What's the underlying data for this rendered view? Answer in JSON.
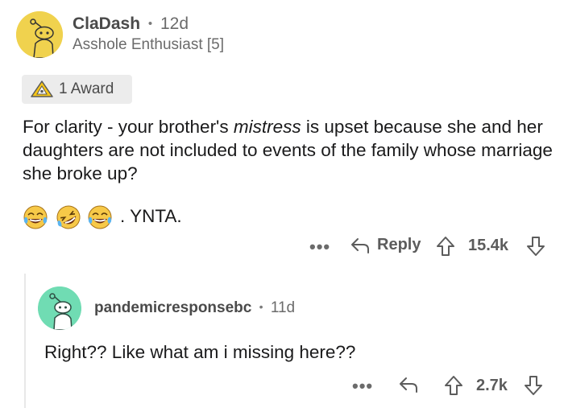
{
  "comment": {
    "author": "ClaDash",
    "separator": "•",
    "age": "12d",
    "flair": "Asshole Enthusiast [5]",
    "award_label": "1 Award",
    "text_part1": "For clarity - your brother's ",
    "text_italic": "mistress",
    "text_part2": " is upset because she and her daughters are not included to events of the family whose marriage she broke up?",
    "emoji_suffix": ". YNTA.",
    "emojis": [
      "joy-emoji",
      "rofl-emoji",
      "joy-emoji"
    ],
    "more_label": "•••",
    "reply_label": "Reply",
    "score": "15.4k"
  },
  "reply": {
    "author": "pandemicresponsebc",
    "separator": "•",
    "age": "11d",
    "text": "Right?? Like what am i missing here??",
    "more_label": "•••",
    "score": "2.7k"
  },
  "colors": {
    "avatar1_bg": "#f0d24e",
    "avatar2_bg": "#70dcb3",
    "award_bg": "#ececec",
    "meta_text": "#6b6b6b"
  }
}
